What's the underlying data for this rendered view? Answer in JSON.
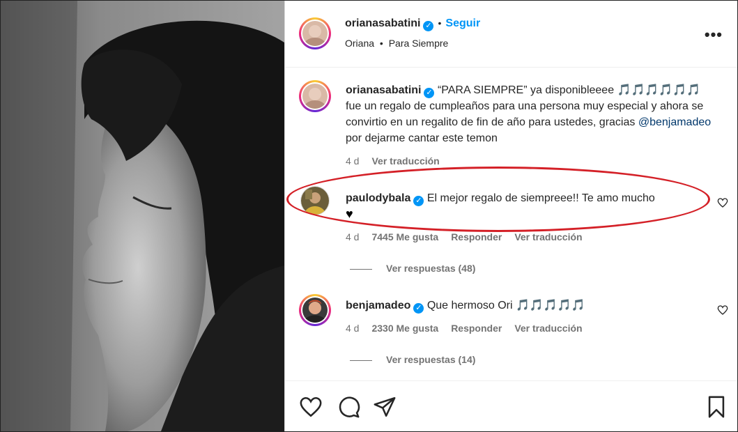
{
  "post_header": {
    "username": "orianasabatini",
    "verified_glyph": "✓",
    "separator": "•",
    "follow_label": "Seguir",
    "sub_author": "Oriana",
    "sub_separator": "•",
    "sub_track": "Para Siempre",
    "more_label": "•••"
  },
  "caption": {
    "username": "orianasabatini",
    "text_before_mention": "“PARA SIEMPRE” ya disponibleeee 🎵🎵🎵🎵🎵🎵 fue un regalo de cumpleaños para una persona muy especial y ahora se convirtio en un regalito de fin de año para ustedes, gracias ",
    "mention": "@benjamadeo",
    "text_after_mention": " por dejarme cantar este temon",
    "time": "4 d",
    "translate": "Ver traducción"
  },
  "comments": [
    {
      "username": "paulodybala",
      "text": "El mejor regalo de siempreee!! Te amo mucho",
      "emoji": "♥",
      "time": "4 d",
      "likes": "7445 Me gusta",
      "reply": "Responder",
      "translate": "Ver traducción",
      "view_replies": "Ver respuestas (48)"
    },
    {
      "username": "benjamadeo",
      "text": "Que hermoso Ori 🎵🎵🎵🎵🎵",
      "time": "4 d",
      "likes": "2330 Me gusta",
      "reply": "Responder",
      "translate": "Ver traducción",
      "view_replies": "Ver respuestas (14)"
    }
  ],
  "actions": [
    "heart-icon",
    "comment-icon",
    "share-icon",
    "bookmark-icon"
  ],
  "colors": {
    "accent": "#0095f6",
    "highlight_ellipse": "#d42027",
    "text": "#262626",
    "muted": "#737373"
  }
}
